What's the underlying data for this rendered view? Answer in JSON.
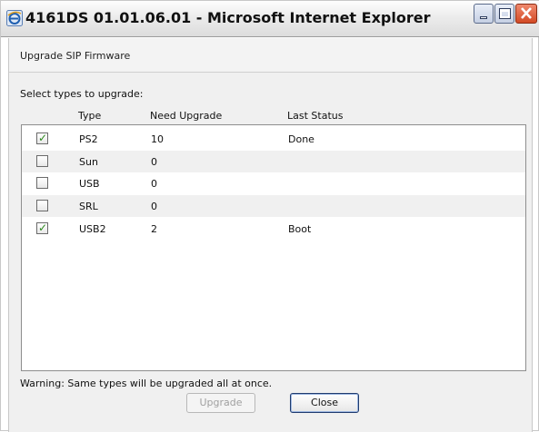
{
  "window": {
    "title": "4161DS 01.01.06.01 - Microsoft Internet Explorer"
  },
  "dialog": {
    "header": "Upgrade SIP Firmware",
    "prompt": "Select types to upgrade:",
    "columns": [
      "Type",
      "Need Upgrade",
      "Last Status"
    ],
    "rows": [
      {
        "checked": true,
        "type": "PS2",
        "need_upgrade": "10",
        "last_status": "Done"
      },
      {
        "checked": false,
        "type": "Sun",
        "need_upgrade": "0",
        "last_status": ""
      },
      {
        "checked": false,
        "type": "USB",
        "need_upgrade": "0",
        "last_status": ""
      },
      {
        "checked": false,
        "type": "SRL",
        "need_upgrade": "0",
        "last_status": ""
      },
      {
        "checked": true,
        "type": "USB2",
        "need_upgrade": "2",
        "last_status": "Boot"
      }
    ],
    "warning": "Warning: Same types will be upgraded all at once.",
    "upgrade_label": "Upgrade",
    "upgrade_disabled": true,
    "close_label": "Close"
  },
  "icons": {
    "app": "internet-explorer-icon",
    "minimize": "minimize-icon",
    "maximize": "maximize-icon",
    "close": "close-icon",
    "check": "checkmark-icon"
  },
  "colors": {
    "check": "#2d8a1e",
    "close_button": "#d34a25"
  }
}
